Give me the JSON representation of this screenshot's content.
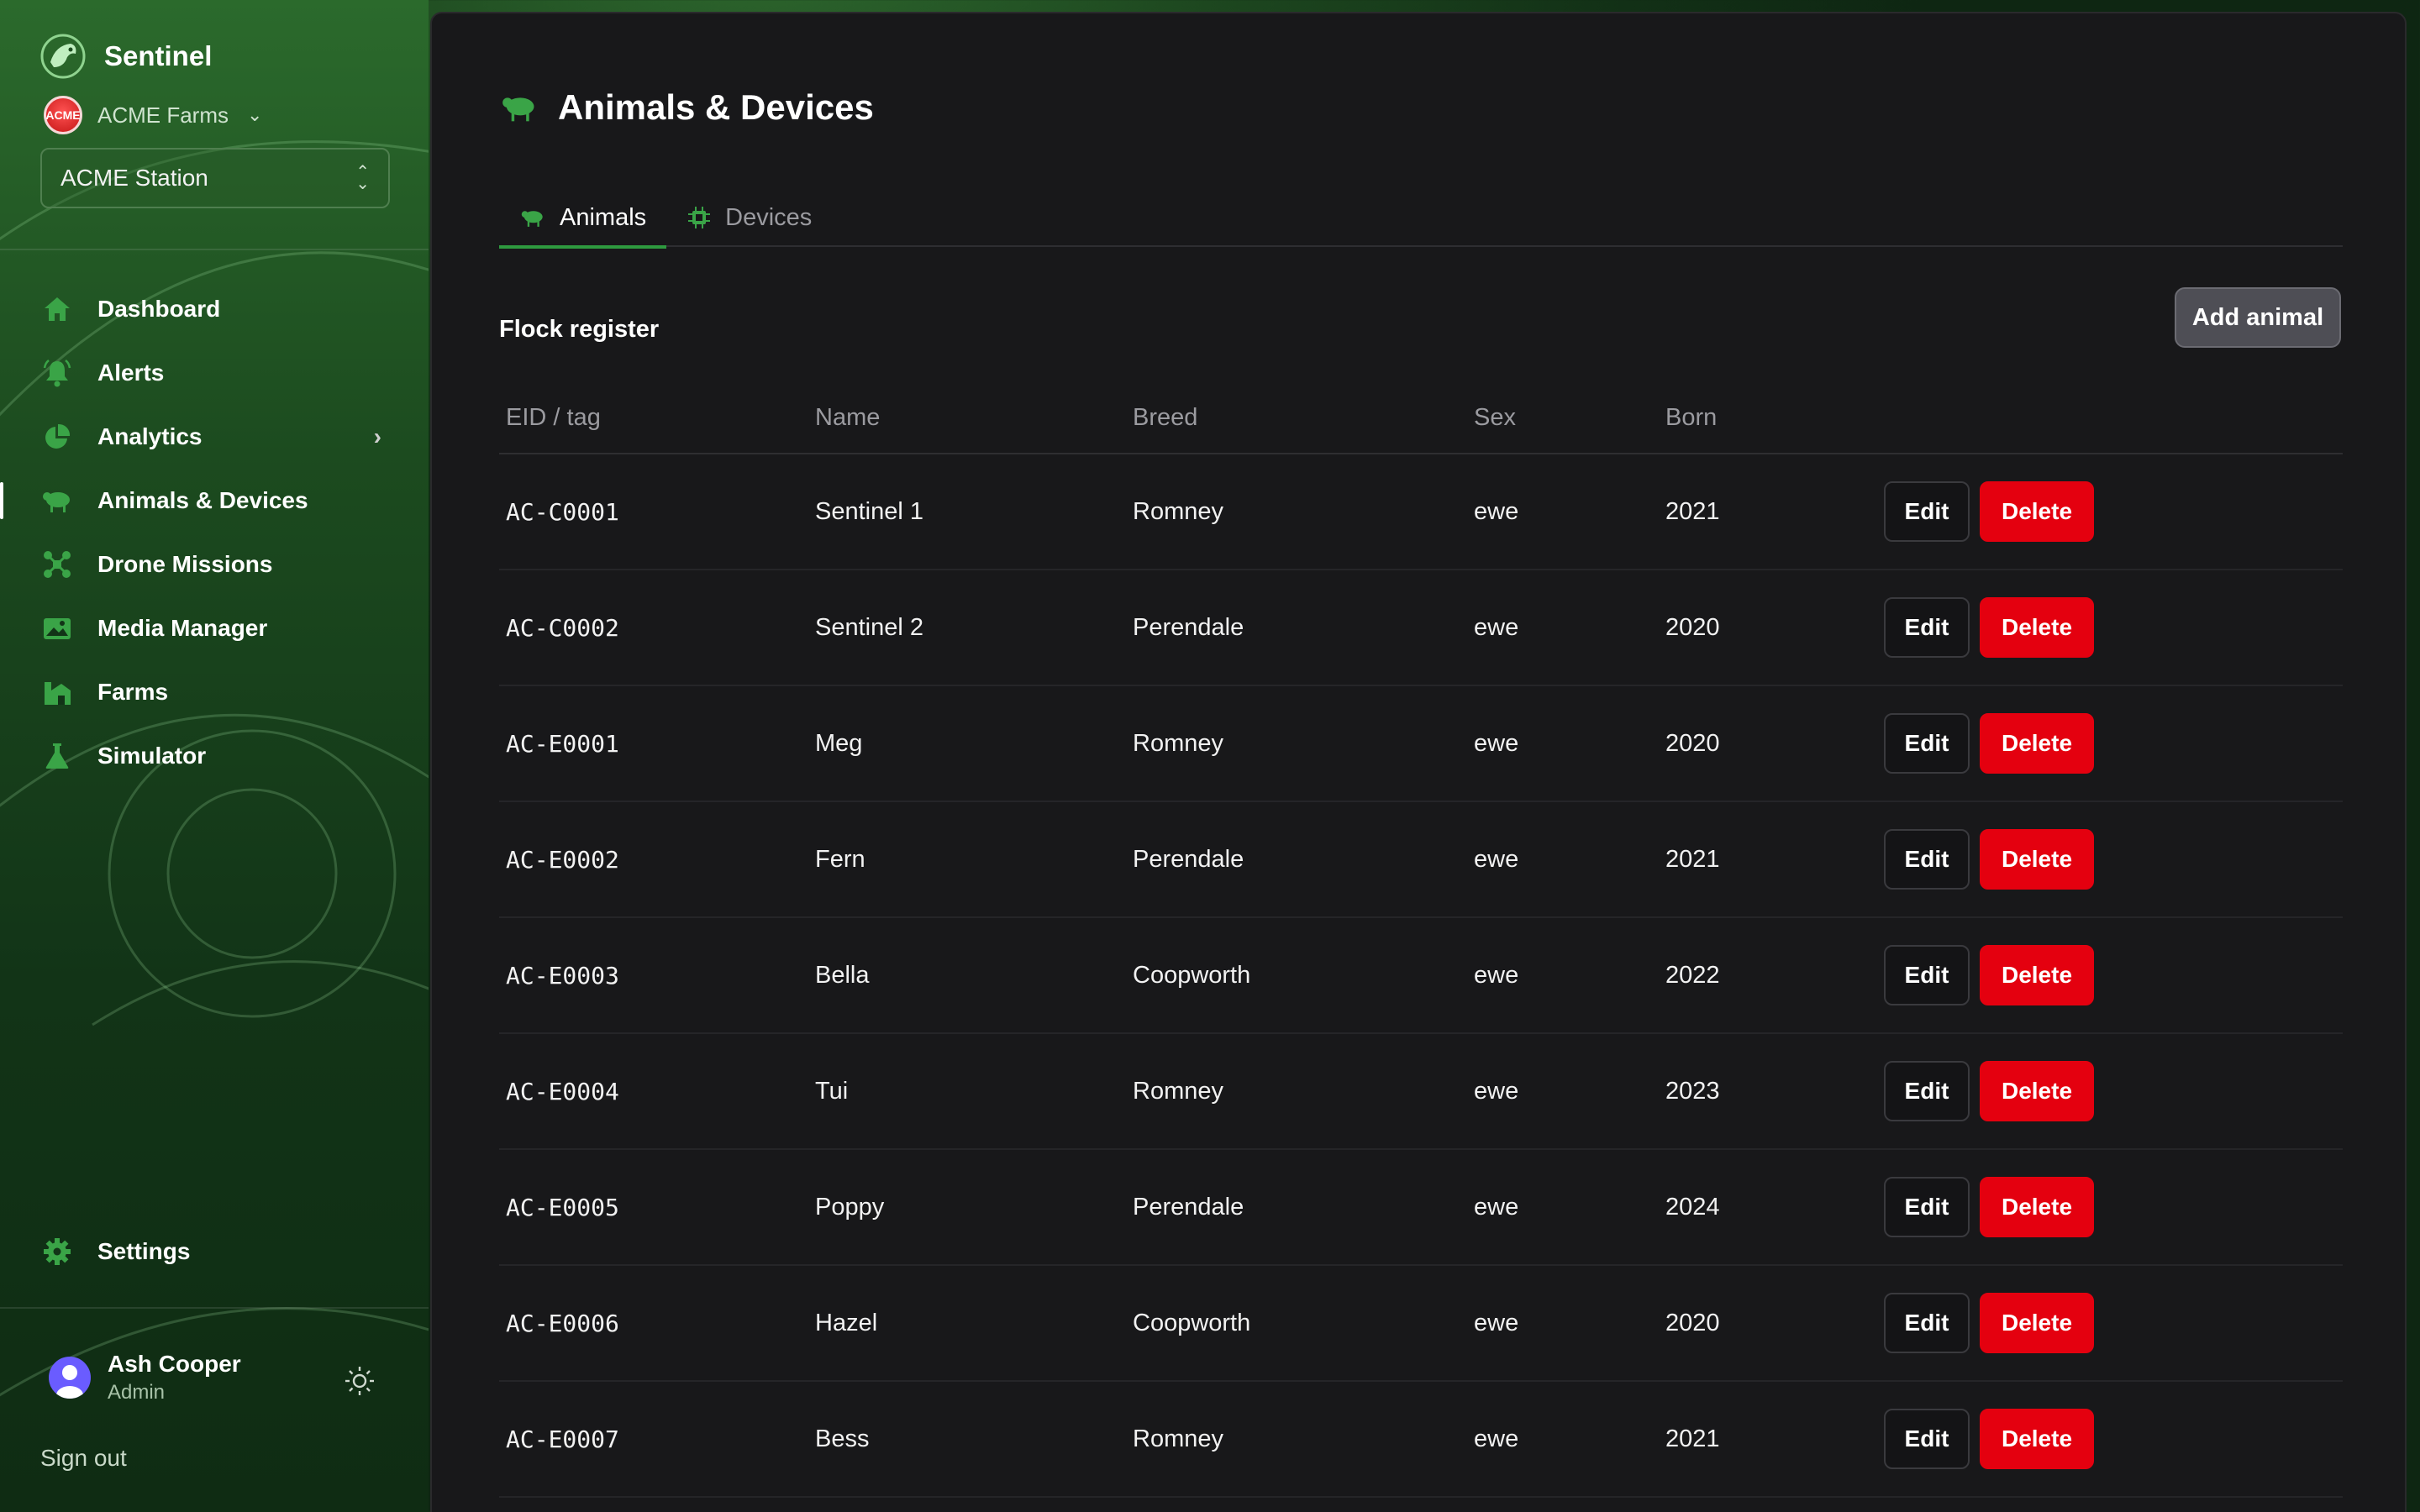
{
  "app": {
    "name": "Sentinel"
  },
  "org": {
    "logo_text": "ACME",
    "name": "ACME Farms"
  },
  "station": {
    "selected": "ACME Station"
  },
  "nav": [
    {
      "label": "Dashboard",
      "icon": "home-icon"
    },
    {
      "label": "Alerts",
      "icon": "bell-icon"
    },
    {
      "label": "Analytics",
      "icon": "pie-chart-icon"
    },
    {
      "label": "Animals & Devices",
      "icon": "sheep-icon"
    },
    {
      "label": "Drone Missions",
      "icon": "drone-icon"
    },
    {
      "label": "Media Manager",
      "icon": "image-icon"
    },
    {
      "label": "Farms",
      "icon": "farm-icon"
    },
    {
      "label": "Simulator",
      "icon": "flask-icon"
    }
  ],
  "settings": {
    "label": "Settings",
    "icon": "gear-icon"
  },
  "user": {
    "name": "Ash Cooper",
    "role": "Admin"
  },
  "signout": {
    "label": "Sign out"
  },
  "page": {
    "title": "Animals & Devices"
  },
  "tabs": [
    {
      "label": "Animals",
      "icon": "sheep-icon"
    },
    {
      "label": "Devices",
      "icon": "chip-icon"
    }
  ],
  "section": {
    "title": "Flock register",
    "add_label": "Add animal"
  },
  "table": {
    "columns": [
      "EID / tag",
      "Name",
      "Breed",
      "Sex",
      "Born"
    ],
    "edit_label": "Edit",
    "delete_label": "Delete",
    "rows": [
      {
        "eid": "AC-C0001",
        "name": "Sentinel 1",
        "breed": "Romney",
        "sex": "ewe",
        "born": "2021"
      },
      {
        "eid": "AC-C0002",
        "name": "Sentinel 2",
        "breed": "Perendale",
        "sex": "ewe",
        "born": "2020"
      },
      {
        "eid": "AC-E0001",
        "name": "Meg",
        "breed": "Romney",
        "sex": "ewe",
        "born": "2020"
      },
      {
        "eid": "AC-E0002",
        "name": "Fern",
        "breed": "Perendale",
        "sex": "ewe",
        "born": "2021"
      },
      {
        "eid": "AC-E0003",
        "name": "Bella",
        "breed": "Coopworth",
        "sex": "ewe",
        "born": "2022"
      },
      {
        "eid": "AC-E0004",
        "name": "Tui",
        "breed": "Romney",
        "sex": "ewe",
        "born": "2023"
      },
      {
        "eid": "AC-E0005",
        "name": "Poppy",
        "breed": "Perendale",
        "sex": "ewe",
        "born": "2024"
      },
      {
        "eid": "AC-E0006",
        "name": "Hazel",
        "breed": "Coopworth",
        "sex": "ewe",
        "born": "2020"
      },
      {
        "eid": "AC-E0007",
        "name": "Bess",
        "breed": "Romney",
        "sex": "ewe",
        "born": "2021"
      }
    ]
  },
  "colors": {
    "accent": "#2e9a3f",
    "danger": "#e4000f",
    "panel": "#18181a"
  }
}
